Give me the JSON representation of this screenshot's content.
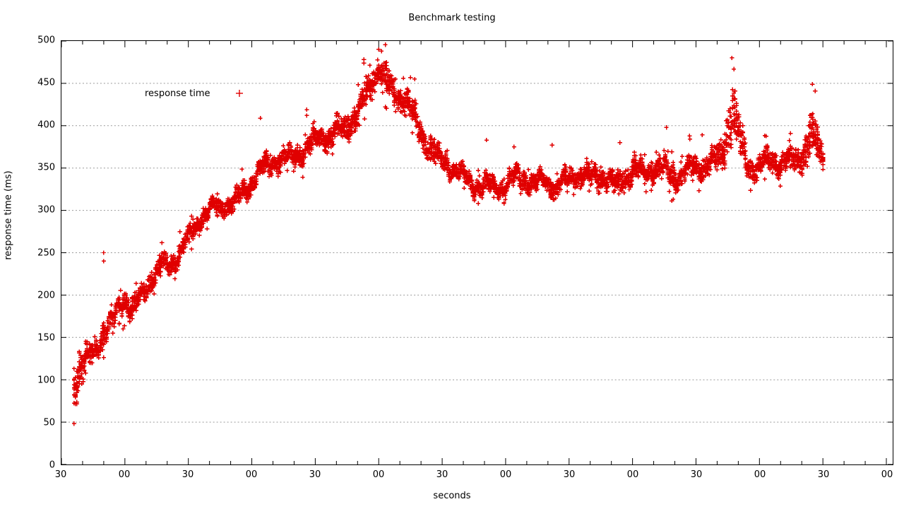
{
  "chart_data": {
    "type": "scatter",
    "title": "Benchmark testing",
    "xlabel": "seconds",
    "ylabel": "response time (ms)",
    "grid": "horizontal-dotted",
    "legend_position": "top-left-inside",
    "series": [
      {
        "name": "response time",
        "color": "#e00000",
        "marker": "plus",
        "point_count": 4400
      }
    ],
    "ylim": [
      0,
      500
    ],
    "ytick_step": 50,
    "ytick_labels": [
      "0",
      "50",
      "100",
      "150",
      "200",
      "250",
      "300",
      "350",
      "400",
      "450",
      "500"
    ],
    "ytick_values": [
      0,
      50,
      100,
      150,
      200,
      250,
      300,
      350,
      400,
      450,
      500
    ],
    "xtick_labels": [
      "30",
      "00",
      "30",
      "00",
      "30",
      "00",
      "30",
      "00",
      "30",
      "00",
      "30",
      "00",
      "30",
      "00"
    ],
    "xtick_values": [
      0,
      30,
      60,
      90,
      120,
      150,
      180,
      210,
      240,
      270,
      300,
      330,
      360,
      390
    ],
    "xlim": [
      0,
      393
    ],
    "x_minor_ticks_per_major": 2,
    "profile_note": "response time ramps from ~35ms up to a ~490ms peak near t=150s, decays to a ~335ms plateau, with late spikes to ~480ms and ~450ms",
    "profile": [
      {
        "x": 6,
        "mid": 90,
        "spread": 55
      },
      {
        "x": 9,
        "mid": 108,
        "spread": 32
      },
      {
        "x": 12,
        "mid": 120,
        "spread": 22
      },
      {
        "x": 15,
        "mid": 132,
        "spread": 20
      },
      {
        "x": 18,
        "mid": 150,
        "spread": 22
      },
      {
        "x": 21,
        "mid": 163,
        "spread": 20
      },
      {
        "x": 24,
        "mid": 172,
        "spread": 22
      },
      {
        "x": 27,
        "mid": 188,
        "spread": 20
      },
      {
        "x": 30,
        "mid": 196,
        "spread": 20
      },
      {
        "x": 33,
        "mid": 178,
        "spread": 22
      },
      {
        "x": 36,
        "mid": 186,
        "spread": 20
      },
      {
        "x": 39,
        "mid": 200,
        "spread": 18
      },
      {
        "x": 42,
        "mid": 214,
        "spread": 18
      },
      {
        "x": 45,
        "mid": 228,
        "spread": 20
      },
      {
        "x": 48,
        "mid": 240,
        "spread": 24
      },
      {
        "x": 51,
        "mid": 240,
        "spread": 20
      },
      {
        "x": 54,
        "mid": 248,
        "spread": 18
      },
      {
        "x": 57,
        "mid": 258,
        "spread": 18
      },
      {
        "x": 60,
        "mid": 266,
        "spread": 18
      },
      {
        "x": 63,
        "mid": 276,
        "spread": 18
      },
      {
        "x": 66,
        "mid": 288,
        "spread": 18
      },
      {
        "x": 69,
        "mid": 294,
        "spread": 18
      },
      {
        "x": 72,
        "mid": 300,
        "spread": 18
      },
      {
        "x": 75,
        "mid": 304,
        "spread": 18
      },
      {
        "x": 78,
        "mid": 310,
        "spread": 20
      },
      {
        "x": 81,
        "mid": 314,
        "spread": 20
      },
      {
        "x": 84,
        "mid": 322,
        "spread": 20
      },
      {
        "x": 87,
        "mid": 328,
        "spread": 20
      },
      {
        "x": 90,
        "mid": 334,
        "spread": 22
      },
      {
        "x": 93,
        "mid": 340,
        "spread": 20
      },
      {
        "x": 96,
        "mid": 346,
        "spread": 20
      },
      {
        "x": 99,
        "mid": 352,
        "spread": 20
      },
      {
        "x": 102,
        "mid": 356,
        "spread": 20
      },
      {
        "x": 105,
        "mid": 362,
        "spread": 20
      },
      {
        "x": 108,
        "mid": 366,
        "spread": 20
      },
      {
        "x": 111,
        "mid": 370,
        "spread": 20
      },
      {
        "x": 114,
        "mid": 374,
        "spread": 20
      },
      {
        "x": 117,
        "mid": 378,
        "spread": 20
      },
      {
        "x": 120,
        "mid": 382,
        "spread": 20
      },
      {
        "x": 123,
        "mid": 384,
        "spread": 20
      },
      {
        "x": 126,
        "mid": 382,
        "spread": 22
      },
      {
        "x": 129,
        "mid": 386,
        "spread": 20
      },
      {
        "x": 132,
        "mid": 392,
        "spread": 22
      },
      {
        "x": 135,
        "mid": 400,
        "spread": 24
      },
      {
        "x": 138,
        "mid": 412,
        "spread": 26
      },
      {
        "x": 141,
        "mid": 426,
        "spread": 28
      },
      {
        "x": 144,
        "mid": 440,
        "spread": 28
      },
      {
        "x": 147,
        "mid": 456,
        "spread": 28
      },
      {
        "x": 150,
        "mid": 468,
        "spread": 26
      },
      {
        "x": 153,
        "mid": 452,
        "spread": 28
      },
      {
        "x": 156,
        "mid": 438,
        "spread": 26
      },
      {
        "x": 159,
        "mid": 428,
        "spread": 26
      },
      {
        "x": 162,
        "mid": 432,
        "spread": 26
      },
      {
        "x": 165,
        "mid": 420,
        "spread": 26
      },
      {
        "x": 168,
        "mid": 404,
        "spread": 26
      },
      {
        "x": 171,
        "mid": 392,
        "spread": 26
      },
      {
        "x": 174,
        "mid": 380,
        "spread": 24
      },
      {
        "x": 177,
        "mid": 368,
        "spread": 22
      },
      {
        "x": 180,
        "mid": 358,
        "spread": 20
      },
      {
        "x": 183,
        "mid": 350,
        "spread": 20
      },
      {
        "x": 186,
        "mid": 344,
        "spread": 18
      },
      {
        "x": 189,
        "mid": 338,
        "spread": 18
      },
      {
        "x": 192,
        "mid": 334,
        "spread": 18
      },
      {
        "x": 195,
        "mid": 330,
        "spread": 18
      },
      {
        "x": 198,
        "mid": 332,
        "spread": 18
      },
      {
        "x": 201,
        "mid": 336,
        "spread": 20
      },
      {
        "x": 204,
        "mid": 334,
        "spread": 20
      },
      {
        "x": 207,
        "mid": 330,
        "spread": 20
      },
      {
        "x": 210,
        "mid": 328,
        "spread": 20
      },
      {
        "x": 213,
        "mid": 332,
        "spread": 20
      },
      {
        "x": 216,
        "mid": 336,
        "spread": 20
      },
      {
        "x": 219,
        "mid": 334,
        "spread": 20
      },
      {
        "x": 222,
        "mid": 330,
        "spread": 20
      },
      {
        "x": 225,
        "mid": 334,
        "spread": 20
      },
      {
        "x": 228,
        "mid": 338,
        "spread": 20
      },
      {
        "x": 231,
        "mid": 336,
        "spread": 20
      },
      {
        "x": 234,
        "mid": 332,
        "spread": 20
      },
      {
        "x": 237,
        "mid": 334,
        "spread": 20
      },
      {
        "x": 240,
        "mid": 338,
        "spread": 20
      },
      {
        "x": 243,
        "mid": 340,
        "spread": 20
      },
      {
        "x": 246,
        "mid": 336,
        "spread": 20
      },
      {
        "x": 249,
        "mid": 334,
        "spread": 20
      },
      {
        "x": 252,
        "mid": 338,
        "spread": 20
      },
      {
        "x": 255,
        "mid": 342,
        "spread": 22
      },
      {
        "x": 258,
        "mid": 340,
        "spread": 20
      },
      {
        "x": 261,
        "mid": 336,
        "spread": 20
      },
      {
        "x": 264,
        "mid": 338,
        "spread": 20
      },
      {
        "x": 267,
        "mid": 342,
        "spread": 20
      },
      {
        "x": 270,
        "mid": 346,
        "spread": 22
      },
      {
        "x": 273,
        "mid": 344,
        "spread": 20
      },
      {
        "x": 276,
        "mid": 340,
        "spread": 20
      },
      {
        "x": 279,
        "mid": 344,
        "spread": 22
      },
      {
        "x": 282,
        "mid": 348,
        "spread": 22
      },
      {
        "x": 285,
        "mid": 350,
        "spread": 22
      },
      {
        "x": 288,
        "mid": 346,
        "spread": 22
      },
      {
        "x": 291,
        "mid": 344,
        "spread": 22
      },
      {
        "x": 294,
        "mid": 348,
        "spread": 22
      },
      {
        "x": 297,
        "mid": 352,
        "spread": 22
      },
      {
        "x": 300,
        "mid": 350,
        "spread": 22
      },
      {
        "x": 303,
        "mid": 346,
        "spread": 22
      },
      {
        "x": 306,
        "mid": 350,
        "spread": 22
      },
      {
        "x": 309,
        "mid": 356,
        "spread": 24
      },
      {
        "x": 312,
        "mid": 360,
        "spread": 24
      },
      {
        "x": 315,
        "mid": 400,
        "spread": 60
      },
      {
        "x": 318,
        "mid": 420,
        "spread": 62
      },
      {
        "x": 321,
        "mid": 390,
        "spread": 50
      },
      {
        "x": 324,
        "mid": 360,
        "spread": 26
      },
      {
        "x": 327,
        "mid": 352,
        "spread": 22
      },
      {
        "x": 330,
        "mid": 350,
        "spread": 22
      },
      {
        "x": 333,
        "mid": 354,
        "spread": 24
      },
      {
        "x": 336,
        "mid": 356,
        "spread": 24
      },
      {
        "x": 339,
        "mid": 352,
        "spread": 22
      },
      {
        "x": 342,
        "mid": 356,
        "spread": 26
      },
      {
        "x": 345,
        "mid": 360,
        "spread": 28
      },
      {
        "x": 348,
        "mid": 362,
        "spread": 26
      },
      {
        "x": 351,
        "mid": 372,
        "spread": 34
      },
      {
        "x": 354,
        "mid": 400,
        "spread": 46
      },
      {
        "x": 357,
        "mid": 384,
        "spread": 42
      },
      {
        "x": 360,
        "mid": 362,
        "spread": 26
      }
    ],
    "outliers": [
      {
        "x": 20,
        "y": 250
      },
      {
        "x": 20,
        "y": 240
      },
      {
        "x": 94,
        "y": 409
      },
      {
        "x": 116,
        "y": 419
      },
      {
        "x": 116,
        "y": 412
      },
      {
        "x": 143,
        "y": 478
      },
      {
        "x": 143,
        "y": 474
      },
      {
        "x": 150,
        "y": 490
      },
      {
        "x": 165,
        "y": 457
      },
      {
        "x": 167,
        "y": 455
      },
      {
        "x": 201,
        "y": 383
      },
      {
        "x": 214,
        "y": 375
      },
      {
        "x": 232,
        "y": 377
      },
      {
        "x": 264,
        "y": 380
      },
      {
        "x": 286,
        "y": 398
      },
      {
        "x": 297,
        "y": 388
      },
      {
        "x": 303,
        "y": 389
      },
      {
        "x": 317,
        "y": 480
      },
      {
        "x": 355,
        "y": 449
      }
    ]
  },
  "legend": {
    "label": "response time",
    "marker": "plus-icon"
  },
  "axes": {
    "title": "Benchmark testing",
    "x_title": "seconds",
    "y_title": "response time (ms)"
  },
  "colors": {
    "data": "#e00000",
    "axis": "#000000",
    "grid": "#9a9a9a",
    "background": "#ffffff"
  }
}
